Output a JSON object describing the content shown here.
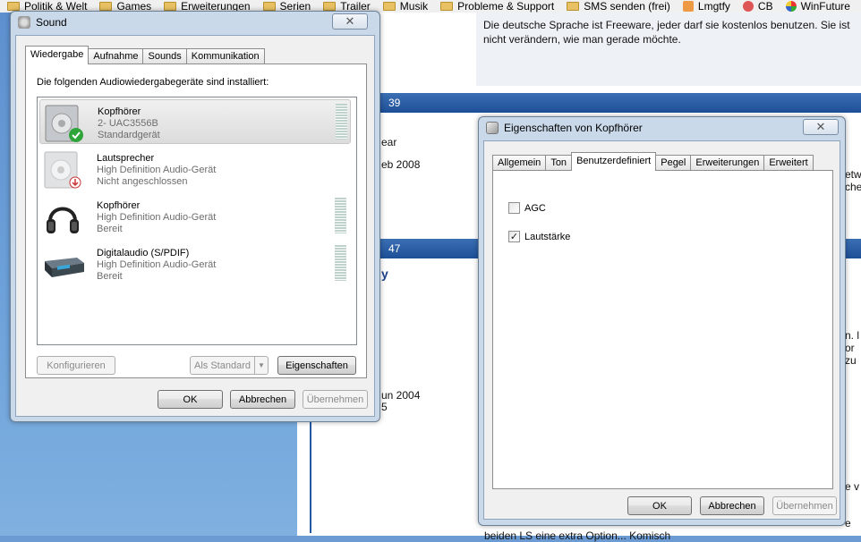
{
  "bookmarks": [
    {
      "label": "Politik & Welt",
      "icon": "folder-icon"
    },
    {
      "label": "Games",
      "icon": "folder-icon"
    },
    {
      "label": "Erweiterungen",
      "icon": "folder-icon"
    },
    {
      "label": "Serien",
      "icon": "folder-icon"
    },
    {
      "label": "Trailer",
      "icon": "folder-icon"
    },
    {
      "label": "Musik",
      "icon": "folder-icon"
    },
    {
      "label": "Probleme & Support",
      "icon": "folder-icon"
    },
    {
      "label": "SMS senden (frei)",
      "icon": "folder-icon"
    },
    {
      "label": "Lmgtfy",
      "icon": "lmgtfy-icon"
    },
    {
      "label": "CB",
      "icon": "cb-icon"
    },
    {
      "label": "WinFuture",
      "icon": "winfuture-icon"
    }
  ],
  "webpage": {
    "top_text_1": "Die deutsche Sprache ist Freeware, jeder darf sie kostenlos benutzen. Sie ist",
    "top_text_2": "nicht verändern, wie man gerade möchte.",
    "bar1": "39",
    "bar2": "47",
    "t_year": "ear",
    "t_feb": "eb 2008",
    "t_y": "y",
    "t_jun": "un 2004",
    "t_5": "5",
    "t_bottom": "beiden LS eine extra Option... Komisch",
    "t_r1": "etw",
    "t_r2": "che",
    "t_r3": "n. l",
    "t_r4": "or",
    "t_r5": "zu",
    "t_r6": "e v",
    "t_r7": "e"
  },
  "sound": {
    "title": "Sound",
    "close": "✕",
    "tabs": [
      "Wiedergabe",
      "Aufnahme",
      "Sounds",
      "Kommunikation"
    ],
    "heading": "Die folgenden Audiowiedergabegeräte sind installiert:",
    "devices": [
      {
        "name": "Kopfhörer",
        "line2": "2- UAC3556B",
        "line3": "Standardgerät",
        "icon": "speaker-default-icon"
      },
      {
        "name": "Lautsprecher",
        "line2": "High Definition Audio-Gerät",
        "line3": "Nicht angeschlossen",
        "icon": "speaker-disconnected-icon"
      },
      {
        "name": "Kopfhörer",
        "line2": "High Definition Audio-Gerät",
        "line3": "Bereit",
        "icon": "headphones-icon"
      },
      {
        "name": "Digitalaudio (S/PDIF)",
        "line2": "High Definition Audio-Gerät",
        "line3": "Bereit",
        "icon": "digital-audio-icon"
      }
    ],
    "btn_configure": "Konfigurieren",
    "btn_default": "Als Standard",
    "btn_properties": "Eigenschaften",
    "btn_ok": "OK",
    "btn_cancel": "Abbrechen",
    "btn_apply": "Übernehmen"
  },
  "props": {
    "title": "Eigenschaften von Kopfhörer",
    "close": "✕",
    "tabs": [
      "Allgemein",
      "Ton",
      "Benutzerdefiniert",
      "Pegel",
      "Erweiterungen",
      "Erweitert"
    ],
    "active_tab": "Benutzerdefiniert",
    "agc_label": "AGC",
    "agc_checked": false,
    "volume_label": "Lautstärke",
    "volume_checked": true,
    "btn_ok": "OK",
    "btn_cancel": "Abbrechen",
    "btn_apply": "Übernehmen"
  },
  "colors": {
    "accent": "#2458a2",
    "window_frame": "#c9d9ea",
    "check_green": "#2fa43a"
  }
}
